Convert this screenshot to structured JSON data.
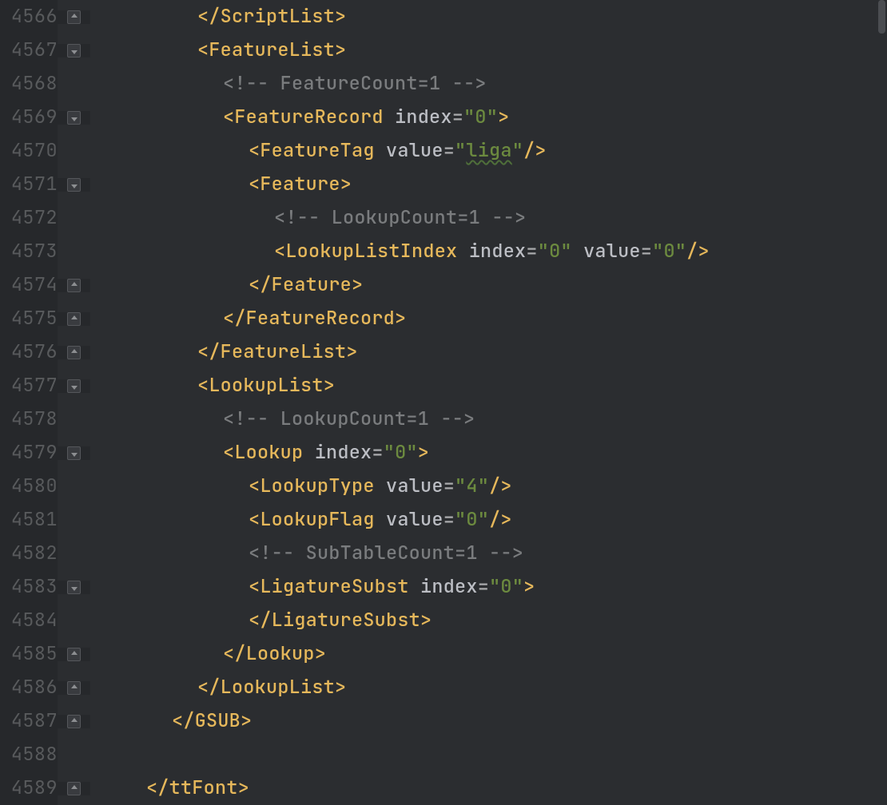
{
  "colors": {
    "bg": "#2b2d30",
    "gutterBg": "#26282b",
    "lineNumber": "#585a5c",
    "bracketTag": "#e6b85b",
    "attrText": "#bcbec4",
    "string": "#6c8a3f",
    "quote": "#6c8a3f",
    "comment": "#7a7c7e",
    "foldBorder": "#55575b",
    "foldChevron": "#8c8e91"
  },
  "lineHeightPx": 42,
  "fontSizePx": 23.4,
  "lines": [
    {
      "ln": 4566,
      "indent": 4,
      "fold": "close",
      "tokens": [
        {
          "t": "bkt",
          "v": "</"
        },
        {
          "t": "tag",
          "v": "ScriptList"
        },
        {
          "t": "bkt",
          "v": ">"
        }
      ]
    },
    {
      "ln": 4567,
      "indent": 4,
      "fold": "open",
      "tokens": [
        {
          "t": "bkt",
          "v": "<"
        },
        {
          "t": "tag",
          "v": "FeatureList"
        },
        {
          "t": "bkt",
          "v": ">"
        }
      ]
    },
    {
      "ln": 4568,
      "indent": 5,
      "fold": null,
      "tokens": [
        {
          "t": "cmt",
          "v": "<!-- FeatureCount=1 -->"
        }
      ]
    },
    {
      "ln": 4569,
      "indent": 5,
      "fold": "open",
      "tokens": [
        {
          "t": "bkt",
          "v": "<"
        },
        {
          "t": "tag",
          "v": "FeatureRecord"
        },
        {
          "t": "txt",
          "v": " "
        },
        {
          "t": "attr",
          "v": "index"
        },
        {
          "t": "eq",
          "v": "="
        },
        {
          "t": "q",
          "v": "\""
        },
        {
          "t": "str",
          "v": "0"
        },
        {
          "t": "q",
          "v": "\""
        },
        {
          "t": "bkt",
          "v": ">"
        }
      ]
    },
    {
      "ln": 4570,
      "indent": 6,
      "fold": null,
      "tokens": [
        {
          "t": "bkt",
          "v": "<"
        },
        {
          "t": "tag",
          "v": "FeatureTag"
        },
        {
          "t": "txt",
          "v": " "
        },
        {
          "t": "attr",
          "v": "value"
        },
        {
          "t": "eq",
          "v": "="
        },
        {
          "t": "q",
          "v": "\""
        },
        {
          "t": "stru",
          "v": "liga"
        },
        {
          "t": "q",
          "v": "\""
        },
        {
          "t": "bkt",
          "v": "/>"
        }
      ]
    },
    {
      "ln": 4571,
      "indent": 6,
      "fold": "open",
      "tokens": [
        {
          "t": "bkt",
          "v": "<"
        },
        {
          "t": "tag",
          "v": "Feature"
        },
        {
          "t": "bkt",
          "v": ">"
        }
      ]
    },
    {
      "ln": 4572,
      "indent": 7,
      "fold": null,
      "tokens": [
        {
          "t": "cmt",
          "v": "<!-- LookupCount=1 -->"
        }
      ]
    },
    {
      "ln": 4573,
      "indent": 7,
      "fold": null,
      "tokens": [
        {
          "t": "bkt",
          "v": "<"
        },
        {
          "t": "tag",
          "v": "LookupListIndex"
        },
        {
          "t": "txt",
          "v": " "
        },
        {
          "t": "attr",
          "v": "index"
        },
        {
          "t": "eq",
          "v": "="
        },
        {
          "t": "q",
          "v": "\""
        },
        {
          "t": "str",
          "v": "0"
        },
        {
          "t": "q",
          "v": "\""
        },
        {
          "t": "txt",
          "v": " "
        },
        {
          "t": "attr",
          "v": "value"
        },
        {
          "t": "eq",
          "v": "="
        },
        {
          "t": "q",
          "v": "\""
        },
        {
          "t": "str",
          "v": "0"
        },
        {
          "t": "q",
          "v": "\""
        },
        {
          "t": "bkt",
          "v": "/>"
        }
      ]
    },
    {
      "ln": 4574,
      "indent": 6,
      "fold": "close",
      "tokens": [
        {
          "t": "bkt",
          "v": "</"
        },
        {
          "t": "tag",
          "v": "Feature"
        },
        {
          "t": "bkt",
          "v": ">"
        }
      ]
    },
    {
      "ln": 4575,
      "indent": 5,
      "fold": "close",
      "tokens": [
        {
          "t": "bkt",
          "v": "</"
        },
        {
          "t": "tag",
          "v": "FeatureRecord"
        },
        {
          "t": "bkt",
          "v": ">"
        }
      ]
    },
    {
      "ln": 4576,
      "indent": 4,
      "fold": "close",
      "tokens": [
        {
          "t": "bkt",
          "v": "</"
        },
        {
          "t": "tag",
          "v": "FeatureList"
        },
        {
          "t": "bkt",
          "v": ">"
        }
      ]
    },
    {
      "ln": 4577,
      "indent": 4,
      "fold": "open",
      "tokens": [
        {
          "t": "bkt",
          "v": "<"
        },
        {
          "t": "tag",
          "v": "LookupList"
        },
        {
          "t": "bkt",
          "v": ">"
        }
      ]
    },
    {
      "ln": 4578,
      "indent": 5,
      "fold": null,
      "tokens": [
        {
          "t": "cmt",
          "v": "<!-- LookupCount=1 -->"
        }
      ]
    },
    {
      "ln": 4579,
      "indent": 5,
      "fold": "open",
      "tokens": [
        {
          "t": "bkt",
          "v": "<"
        },
        {
          "t": "tag",
          "v": "Lookup"
        },
        {
          "t": "txt",
          "v": " "
        },
        {
          "t": "attr",
          "v": "index"
        },
        {
          "t": "eq",
          "v": "="
        },
        {
          "t": "q",
          "v": "\""
        },
        {
          "t": "str",
          "v": "0"
        },
        {
          "t": "q",
          "v": "\""
        },
        {
          "t": "bkt",
          "v": ">"
        }
      ]
    },
    {
      "ln": 4580,
      "indent": 6,
      "fold": null,
      "tokens": [
        {
          "t": "bkt",
          "v": "<"
        },
        {
          "t": "tag",
          "v": "LookupType"
        },
        {
          "t": "txt",
          "v": " "
        },
        {
          "t": "attr",
          "v": "value"
        },
        {
          "t": "eq",
          "v": "="
        },
        {
          "t": "q",
          "v": "\""
        },
        {
          "t": "str",
          "v": "4"
        },
        {
          "t": "q",
          "v": "\""
        },
        {
          "t": "bkt",
          "v": "/>"
        }
      ]
    },
    {
      "ln": 4581,
      "indent": 6,
      "fold": null,
      "tokens": [
        {
          "t": "bkt",
          "v": "<"
        },
        {
          "t": "tag",
          "v": "LookupFlag"
        },
        {
          "t": "txt",
          "v": " "
        },
        {
          "t": "attr",
          "v": "value"
        },
        {
          "t": "eq",
          "v": "="
        },
        {
          "t": "q",
          "v": "\""
        },
        {
          "t": "str",
          "v": "0"
        },
        {
          "t": "q",
          "v": "\""
        },
        {
          "t": "bkt",
          "v": "/>"
        }
      ]
    },
    {
      "ln": 4582,
      "indent": 6,
      "fold": null,
      "tokens": [
        {
          "t": "cmt",
          "v": "<!-- SubTableCount=1 -->"
        }
      ]
    },
    {
      "ln": 4583,
      "indent": 6,
      "fold": "open",
      "tokens": [
        {
          "t": "bkt",
          "v": "<"
        },
        {
          "t": "tag",
          "v": "LigatureSubst"
        },
        {
          "t": "txt",
          "v": " "
        },
        {
          "t": "attr",
          "v": "index"
        },
        {
          "t": "eq",
          "v": "="
        },
        {
          "t": "q",
          "v": "\""
        },
        {
          "t": "str",
          "v": "0"
        },
        {
          "t": "q",
          "v": "\""
        },
        {
          "t": "bkt",
          "v": ">"
        }
      ]
    },
    {
      "ln": 4584,
      "indent": 6,
      "fold": null,
      "tokens": [
        {
          "t": "bkt",
          "v": "</"
        },
        {
          "t": "tag",
          "v": "LigatureSubst"
        },
        {
          "t": "bkt",
          "v": ">"
        }
      ]
    },
    {
      "ln": 4585,
      "indent": 5,
      "fold": "close",
      "tokens": [
        {
          "t": "bkt",
          "v": "</"
        },
        {
          "t": "tag",
          "v": "Lookup"
        },
        {
          "t": "bkt",
          "v": ">"
        }
      ]
    },
    {
      "ln": 4586,
      "indent": 4,
      "fold": "close",
      "tokens": [
        {
          "t": "bkt",
          "v": "</"
        },
        {
          "t": "tag",
          "v": "LookupList"
        },
        {
          "t": "bkt",
          "v": ">"
        }
      ]
    },
    {
      "ln": 4587,
      "indent": 3,
      "fold": "close",
      "tokens": [
        {
          "t": "bkt",
          "v": "</"
        },
        {
          "t": "tag",
          "v": "GSUB"
        },
        {
          "t": "bkt",
          "v": ">"
        }
      ]
    },
    {
      "ln": 4588,
      "indent": 0,
      "fold": null,
      "tokens": []
    },
    {
      "ln": 4589,
      "indent": 2,
      "fold": "close",
      "tokens": [
        {
          "t": "bkt",
          "v": "</"
        },
        {
          "t": "tag",
          "v": "ttFont"
        },
        {
          "t": "bkt",
          "v": ">"
        }
      ]
    }
  ],
  "indentUnitPx": 32,
  "baseLeftPaddingPx": 6
}
